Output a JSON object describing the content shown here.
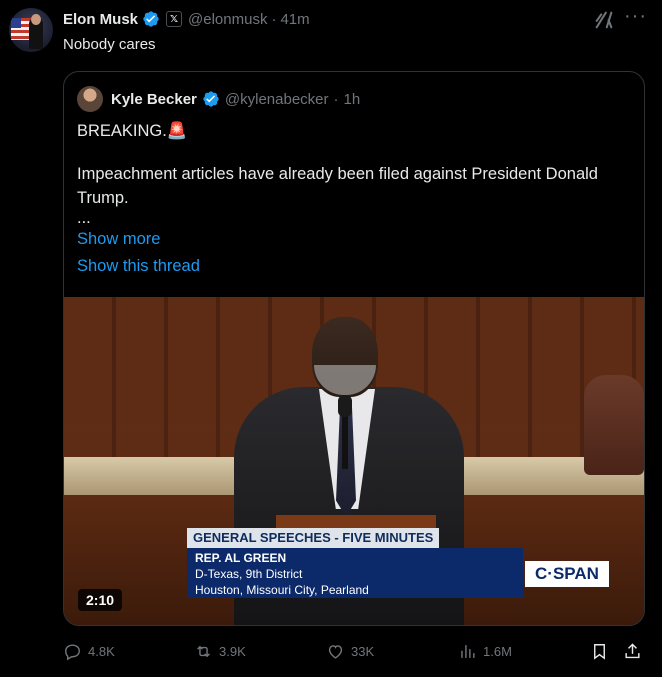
{
  "tweet": {
    "author_name": "Elon Musk",
    "author_handle": "@elonmusk",
    "badge_letter": "𝕏",
    "separator": "·",
    "time": "41m",
    "text": "Nobody cares"
  },
  "quote": {
    "author_name": "Kyle Becker",
    "author_handle": "@kylenabecker",
    "separator": "·",
    "time": "1h",
    "line1": "BREAKING.🚨",
    "line2": "Impeachment articles have already been filed against President Donald Trump.",
    "line3": "...",
    "show_more": "Show more",
    "show_thread": "Show this thread",
    "video": {
      "lower_third_title": "GENERAL SPEECHES - FIVE MINUTES",
      "name": "REP. AL GREEN",
      "district": "D-Texas, 9th District",
      "location": "Houston, Missouri City, Pearland",
      "network": "C·SPAN",
      "duration": "2:10"
    }
  },
  "actions": {
    "replies": "4.8K",
    "reposts": "3.9K",
    "likes": "33K",
    "views": "1.6M"
  },
  "colors": {
    "background": "#000000",
    "text": "#e7e9ea",
    "muted": "#71767b",
    "link": "#1d9bf0",
    "verified": "#1d9bf0",
    "border": "#2f3336"
  },
  "icons": [
    "verified-badge-icon",
    "x-affiliate-badge-icon",
    "grok-icon",
    "more-icon",
    "reply-icon",
    "repost-icon",
    "like-icon",
    "views-icon",
    "bookmark-icon",
    "share-icon"
  ]
}
